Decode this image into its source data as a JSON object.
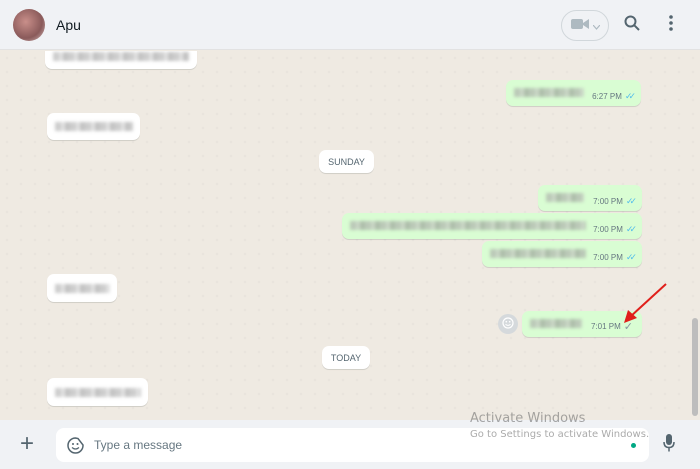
{
  "header": {
    "contact_name": "Apu",
    "icons": [
      "video-icon",
      "chevron-down-icon",
      "search-icon",
      "menu-icon"
    ]
  },
  "chat": {
    "date_chips": [
      "SUNDAY",
      "TODAY"
    ],
    "outgoing": [
      {
        "time": "6:27 PM",
        "status": "read"
      },
      {
        "time": "7:00 PM",
        "status": "read"
      },
      {
        "time": "7:00 PM",
        "status": "read"
      },
      {
        "time": "7:00 PM",
        "status": "read"
      },
      {
        "time": "7:01 PM",
        "status": "sent"
      }
    ]
  },
  "footer": {
    "placeholder": "Type a message",
    "icons": [
      "plus-icon",
      "sticker-icon",
      "mic-icon"
    ]
  },
  "watermark": {
    "line1": "Activate Windows",
    "line2": "Go to Settings to activate Windows."
  },
  "colors": {
    "outgoing_bubble": "#d9fdd3",
    "incoming_bubble": "#ffffff",
    "read_tick": "#53bdeb",
    "annotation_arrow": "#e0201b"
  }
}
